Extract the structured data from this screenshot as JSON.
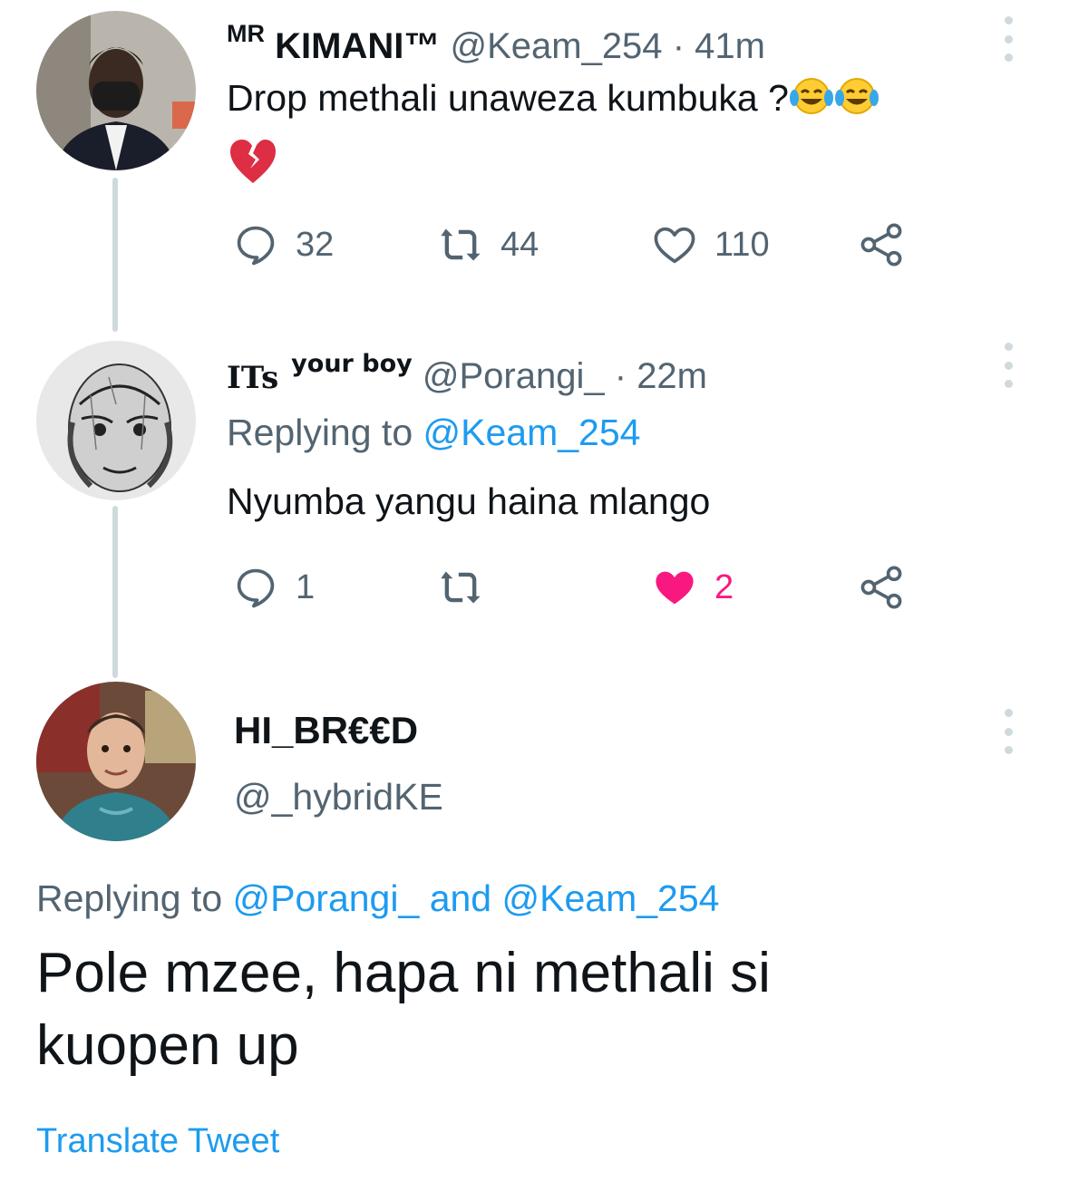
{
  "tweets": [
    {
      "display_name": "KIMANI™",
      "display_prefix": "MR",
      "handle": "@Keam_254",
      "separator": "·",
      "time": "41m",
      "text": "Drop methali unaweza kumbuka ?",
      "emojis": [
        "face-with-tears-of-joy",
        "face-with-tears-of-joy",
        "broken-heart"
      ],
      "stats": {
        "replies": "32",
        "retweets": "44",
        "likes": "110"
      },
      "liked": false
    },
    {
      "display_name": "ITs",
      "display_suffix": "your boy",
      "handle": "@Porangi_",
      "separator": "·",
      "time": "22m",
      "replying_label": "Replying to",
      "replying_handle": "@Keam_254",
      "text": "Nyumba yangu haina mlango",
      "stats": {
        "replies": "1",
        "retweets": "",
        "likes": "2"
      },
      "liked": true
    },
    {
      "display_name": "HI_BR€€D",
      "handle": "@_hybridKE",
      "replying_label": "Replying to",
      "replying_handle_1": "@Porangi_",
      "replying_and": "and",
      "replying_handle_2": "@Keam_254",
      "text": "Pole mzee, hapa ni methali si kuopen up",
      "translate_label": "Translate Tweet"
    }
  ],
  "colors": {
    "accent": "#1d9bf0",
    "like": "#f91880",
    "secondary_text": "#536471",
    "thread_line": "#cfd9de"
  },
  "icons": [
    "reply-icon",
    "retweet-icon",
    "like-icon",
    "share-icon",
    "more-options-icon"
  ]
}
